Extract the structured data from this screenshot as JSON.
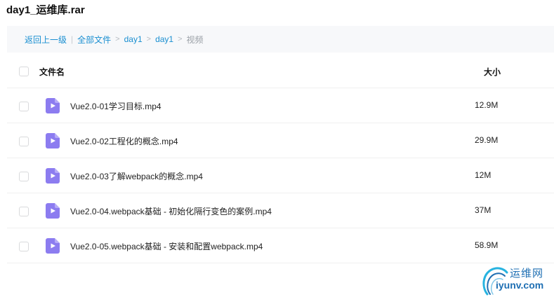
{
  "archive": {
    "title": "day1_运维库.rar"
  },
  "breadcrumb": {
    "back_label": "返回上一级",
    "pipe": "|",
    "all_files_label": "全部文件",
    "items": [
      "day1",
      "day1"
    ],
    "current": "视频",
    "separator": ">"
  },
  "table": {
    "columns": {
      "name": "文件名",
      "size": "大小"
    },
    "rows": [
      {
        "name": "Vue2.0-01学习目标.mp4",
        "size": "12.9M",
        "icon": "video-file-icon"
      },
      {
        "name": "Vue2.0-02工程化的概念.mp4",
        "size": "29.9M",
        "icon": "video-file-icon"
      },
      {
        "name": "Vue2.0-03了解webpack的概念.mp4",
        "size": "12M",
        "icon": "video-file-icon"
      },
      {
        "name": "Vue2.0-04.webpack基础 - 初始化隔行变色的案例.mp4",
        "size": "37M",
        "icon": "video-file-icon"
      },
      {
        "name": "Vue2.0-05.webpack基础 - 安装和配置webpack.mp4",
        "size": "58.9M",
        "icon": "video-file-icon"
      }
    ]
  },
  "watermark": {
    "name_cn": "运维网",
    "domain": "iyunv.com"
  },
  "colors": {
    "link": "#1a8fd1",
    "icon": "#8c7cf0",
    "watermark": "#1f6fb3"
  }
}
